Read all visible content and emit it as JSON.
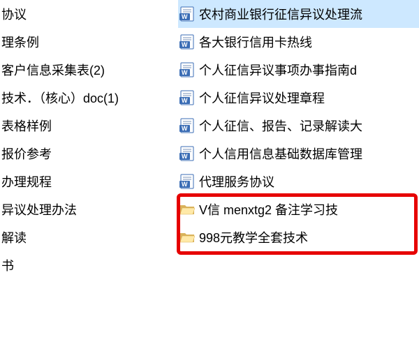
{
  "left_column": [
    {
      "label": "协议"
    },
    {
      "label": "理条例"
    },
    {
      "label": "客户信息采集表(2)"
    },
    {
      "label": "技术．（核心）doc(1)"
    },
    {
      "label": "表格样例"
    },
    {
      "label": "报价参考"
    },
    {
      "label": "办理规程"
    },
    {
      "label": "异议处理办法"
    },
    {
      "label": "解读"
    },
    {
      "label": "书"
    }
  ],
  "right_column": [
    {
      "type": "word",
      "label": "农村商业银行征信异议处理流",
      "selected": true
    },
    {
      "type": "word",
      "label": "各大银行信用卡热线"
    },
    {
      "type": "word",
      "label": "个人征信异议事项办事指南d"
    },
    {
      "type": "word",
      "label": "个人征信异议处理章程"
    },
    {
      "type": "word",
      "label": "个人征信、报告、记录解读大"
    },
    {
      "type": "word",
      "label": "个人信用信息基础数据库管理"
    },
    {
      "type": "word",
      "label": "代理服务协议"
    },
    {
      "type": "folder",
      "label": "V信   menxtg2    备注学习技"
    },
    {
      "type": "folder",
      "label": "998元教学全套技术"
    }
  ]
}
